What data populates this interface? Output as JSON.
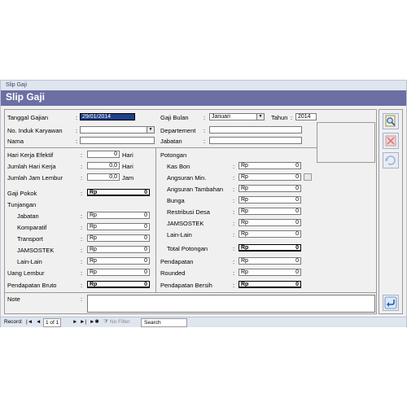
{
  "window": {
    "tab_title": "Slip Gaji",
    "header_title": "Slip Gaji"
  },
  "top": {
    "tanggal_label": "Tanggal Gajian",
    "tanggal_value": "29/01/2014",
    "gaji_bulan_label": "Gaji Bulan",
    "gaji_bulan_value": "Januari",
    "tahun_label": "Tahun",
    "tahun_value": "2014",
    "no_induk_label": "No. Induk Karyawan",
    "no_induk_value": "",
    "departement_label": "Departement",
    "departement_value": "",
    "nama_label": "Nama",
    "nama_value": "",
    "jabatan_label": "Jabatan",
    "jabatan_value": ""
  },
  "left": {
    "hari_kerja_efektif": {
      "label": "Hari Kerja Efektif",
      "value": "0",
      "unit": "Hari"
    },
    "jumlah_hari_kerja": {
      "label": "Jumlah Hari Kerja",
      "value": "0,0",
      "unit": "Hari"
    },
    "jumlah_jam_lembur": {
      "label": "Jumlah Jam Lembur",
      "value": "0,0",
      "unit": "Jam"
    },
    "gaji_pokok": {
      "label": "Gaji Pokok",
      "currency": "Rp",
      "value": "0"
    },
    "tunjangan_label": "Tunjangan",
    "tunjangan": [
      {
        "label": "Jabatan",
        "currency": "Rp",
        "value": "0"
      },
      {
        "label": "Komparatif",
        "currency": "Rp",
        "value": "0"
      },
      {
        "label": "Transport",
        "currency": "Rp",
        "value": "0"
      },
      {
        "label": "JAMSOSTEK",
        "currency": "Rp",
        "value": "0"
      },
      {
        "label": "Lain-Lain",
        "currency": "Rp",
        "value": "0"
      }
    ],
    "uang_lembur": {
      "label": "Uang Lembur",
      "currency": "Rp",
      "value": "0"
    },
    "pendapatan_bruto": {
      "label": "Pendapatan Bruto",
      "currency": "Rp",
      "value": "0"
    }
  },
  "right": {
    "potongan_label": "Potongan",
    "potongan": [
      {
        "label": "Kas Bon",
        "currency": "Rp",
        "value": "0"
      },
      {
        "label": "Angsuran Min.",
        "currency": "Rp",
        "value": "0"
      },
      {
        "label": "Angsuran Tambahan",
        "currency": "Rp",
        "value": "0"
      },
      {
        "label": "Bunga",
        "currency": "Rp",
        "value": "0"
      },
      {
        "label": "Restribusi Desa",
        "currency": "Rp",
        "value": "0"
      },
      {
        "label": "JAMSOSTEK",
        "currency": "Rp",
        "value": "0"
      },
      {
        "label": "Lain-Lain",
        "currency": "Rp",
        "value": "0"
      }
    ],
    "total_potongan": {
      "label": "Total Potongan",
      "currency": "Rp",
      "value": "0"
    },
    "pendapatan": {
      "label": "Pendapatan",
      "currency": "Rp",
      "value": "0"
    },
    "rounded": {
      "label": "Rounded",
      "currency": "Rp",
      "value": "0"
    },
    "pendapatan_bersih": {
      "label": "Pendapatan Bersih",
      "currency": "Rp",
      "value": "0"
    }
  },
  "note": {
    "label": "Note",
    "value": ""
  },
  "colon": ":",
  "statusbar": {
    "record_label": "Record:",
    "record_value": "1 of 1",
    "nav_first": "|◄",
    "nav_prev": "◄",
    "nav_next": "►",
    "nav_last": "►|",
    "nav_new": "►✱",
    "filter_label": "No Filter",
    "search_label": "Search"
  },
  "icons": [
    "search-icon",
    "delete-icon",
    "refresh-icon",
    "back-icon"
  ]
}
